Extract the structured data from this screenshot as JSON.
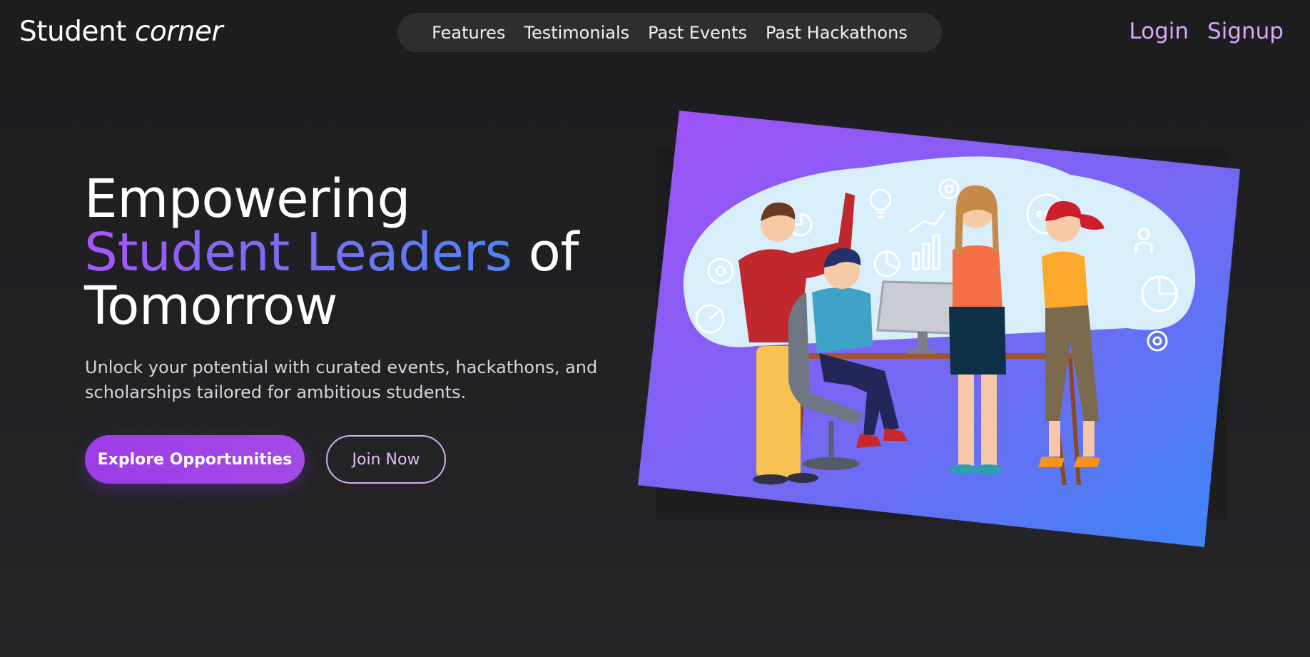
{
  "header": {
    "logo_main": "Student",
    "logo_accent": "corner",
    "nav": [
      "Features",
      "Testimonials",
      "Past Events",
      "Past Hackathons"
    ],
    "login_label": "Login",
    "signup_label": "Signup"
  },
  "hero": {
    "headline_line1": "Empowering",
    "headline_highlight": "Student Leaders",
    "headline_of": "of",
    "headline_line3": "Tomorrow",
    "subtitle": "Unlock your potential with curated events, hackathons, and scholarships tailored for ambitious students.",
    "primary_cta": "Explore Opportunities",
    "secondary_cta": "Join Now"
  },
  "colors": {
    "accent_purple": "#a855f7",
    "accent_blue": "#3b82f6",
    "link_lilac": "#d8a6f8",
    "background": "#1e1e21"
  },
  "icons": [
    "lightbulb-icon",
    "gear-icon",
    "chart-icon",
    "speech-bubble-icon",
    "person-icon",
    "pie-chart-icon"
  ]
}
